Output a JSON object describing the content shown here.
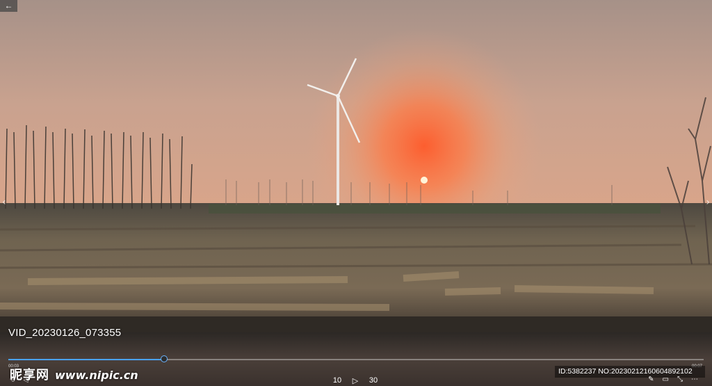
{
  "player": {
    "filename": "VID_20230126_073355",
    "progress": 0.224,
    "time_current": "00:03",
    "time_total": "00:07"
  },
  "nav": {
    "back_icon": "←",
    "prev_icon": "‹",
    "next_icon": "›"
  },
  "watermark": {
    "brand": "昵享网",
    "url": "www.nipic.cn"
  },
  "id_info": "ID:5382237 NO:20230212160604892102",
  "controls": {
    "rewind_label": "10",
    "play_icon": "▷",
    "forward_label": "30"
  },
  "tools": {
    "edit_icon": "✎",
    "pip_icon": "▭",
    "collapse_icon": "⤡",
    "more_icon": "⋯"
  },
  "colors": {
    "accent": "#4aa3ff",
    "sky_top": "#b59a8f",
    "sun_glow": "#ff6a3a"
  }
}
